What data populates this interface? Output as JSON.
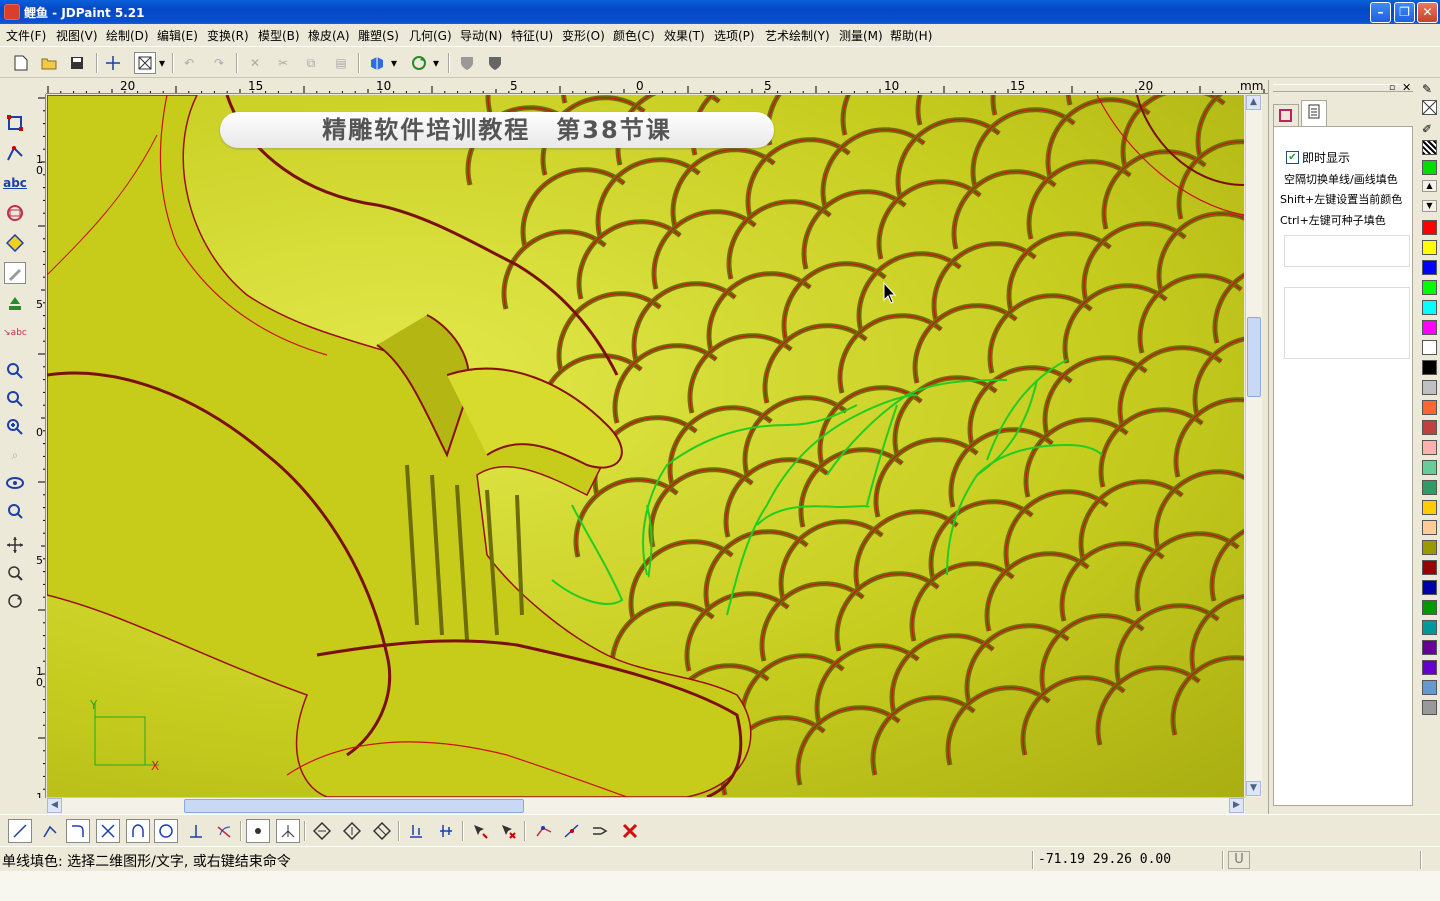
{
  "window": {
    "title": "鲤鱼 - JDPaint 5.21"
  },
  "menu": [
    {
      "label": "文件(F)"
    },
    {
      "label": "视图(V)"
    },
    {
      "label": "绘制(D)"
    },
    {
      "label": "编辑(E)"
    },
    {
      "label": "变换(R)"
    },
    {
      "label": "模型(B)"
    },
    {
      "label": "橡皮(A)"
    },
    {
      "label": "雕塑(S)"
    },
    {
      "label": "几何(G)"
    },
    {
      "label": "导动(N)"
    },
    {
      "label": "特征(U)"
    },
    {
      "label": "变形(O)"
    },
    {
      "label": "颜色(C)"
    },
    {
      "label": "效果(T)"
    },
    {
      "label": "选项(P)"
    },
    {
      "label": "艺术绘制(Y)"
    },
    {
      "label": "测量(M)"
    },
    {
      "label": "帮助(H)"
    }
  ],
  "ruler": {
    "unit": "mm",
    "top_labels": [
      "20",
      "15",
      "10",
      "5",
      "0",
      "5",
      "10",
      "15",
      "20"
    ],
    "left_labels": [
      "1 0",
      "5",
      "0",
      "5",
      "1 0",
      "1"
    ]
  },
  "canvas": {
    "banner": "精雕软件培训教程　第38节课",
    "axis_x": "X",
    "axis_y": "Y",
    "colors": {
      "relief": "#c8cc1f",
      "curves": "#d01010",
      "sketch": "#22cc22"
    }
  },
  "right_panel": {
    "tabs": [
      "node-tab-icon",
      "page-tab-icon"
    ],
    "realtime_checkbox": {
      "label": "即时显示",
      "checked": true
    },
    "hints": [
      "空隔切换单线/画线填色",
      "Shift+左键设置当前颜色",
      "Ctrl+左键可种子填色"
    ]
  },
  "palette": [
    "#00dd00",
    "#ff0000",
    "#ffff00",
    "#0000ff",
    "#00ff00",
    "#00ffff",
    "#ff00ff",
    "#ffffff",
    "#000000",
    "#c0c0c0",
    "#ff6633",
    "#c04040",
    "#ffb0b0",
    "#66cc99",
    "#339966",
    "#ffcc00",
    "#ffcc99",
    "#999900",
    "#990000",
    "#0000aa",
    "#009900",
    "#009999",
    "#660099",
    "#6600cc",
    "#6699cc",
    "#999999"
  ],
  "status": {
    "prompt": "单线填色: 选择二维图形/文字, 或右键结束命令",
    "coords": "-71.19 29.26 0.00",
    "mode": "U"
  }
}
